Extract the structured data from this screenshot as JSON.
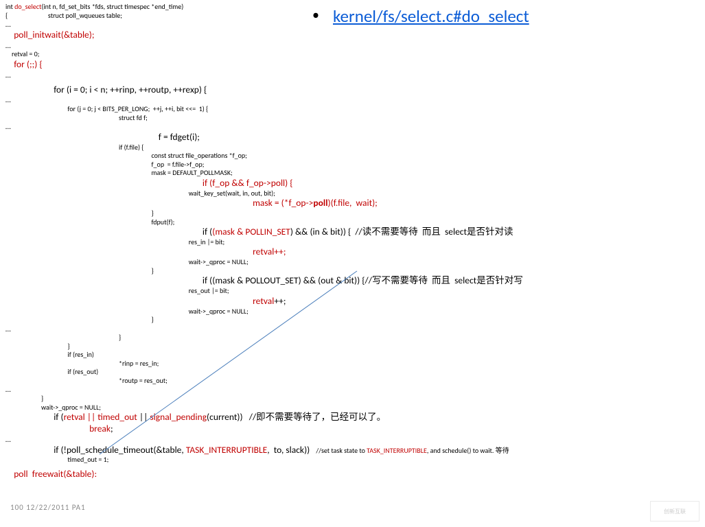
{
  "link_text": " kernel/fs/select.c#do_select",
  "footer": "100   12/22/2011   PA1",
  "watermark": "创新互联",
  "code": {
    "l01a": "int ",
    "l01b": "do_select",
    "l01c": "(int n, fd_set_bits *fds, struct timespec *end_time)",
    "l02": "{                          struct poll_wqueues table;",
    "l03": "…",
    "l04": "    poll_initwait(&table);",
    "l05": "…",
    "l06": "    retval = 0;",
    "l07": "    for (;;) {",
    "l08": "…",
    "l09": "                       for (i = 0; i < n; ++rinp, ++routp, ++rexp) {",
    "l10": "…",
    "l11": "                                        for (j = 0; j < BITS_PER_LONG;  ++j, ++i, bit <<=  1) {",
    "l12": "                                                                         struct fd f;",
    "l13": "…",
    "l14": "                                                                         f = fdget(i);",
    "l15": "                                                                         if (f.file) {",
    "l16": "                                                                                              const struct file_operations *f_op;",
    "l17": "                                                                                              f_op  = f.file->f_op;",
    "l18": "                                                                                              mask = DEFAULT_POLLMASK;",
    "l19a": "                                                                                              ",
    "l19b": "if (f_op && f_op->poll) {",
    "l20": "                                                                                                                      wait_key_set(wait, in, out, bit);",
    "l21a": "                                                                                                                      ",
    "l21b": "mask = (*f_op->",
    "l21c": "poll",
    "l21d": ")(f.file,  wait);",
    "l22": "                                                                                              }",
    "l23": "                                                                                              fdput(f);",
    "l24a": "                                                                                              if (",
    "l24b": "(mask & POLLIN_SET",
    "l24c": ") && (in & bit)) {  //读不需要等待  而且  select是否针对读",
    "l25": "                                                                                                                      res_in |= bit;",
    "l26a": "                                                                                                                      ",
    "l26b": "retval++;",
    "l27": "                                                                                                                      wait->_qproc = NULL;",
    "l28": "                                                                                              }",
    "l29": "                                                                                              if ((mask & POLLOUT_SET) && (out & bit)) {//写不需要等待  而且  select是否针对写",
    "l30": "                                                                                                                      res_out |= bit;",
    "l31a": "                                                                                                                      ",
    "l31b": "retval",
    "l31c": "++;",
    "l32": "                                                                                                                      wait->_qproc = NULL;",
    "l33": "                                                                                              }",
    "l34": "…",
    "l35": "                                                                         }",
    "l36": "                                        }",
    "l37": "                                        if (res_in)",
    "l38": "                                                                         *rinp = res_in;",
    "l39": "                                        if (res_out)",
    "l40": "                                                                         *routp = res_out;",
    "l41": "…",
    "l42": "                       }",
    "l43": "                       wait->_qproc = NULL;",
    "l44a": "                       if (",
    "l44b": "retval || timed_out",
    "l44c": " || ",
    "l44d": "signal_pending",
    "l44e": "(current))   //即不需要等待了，已经可以了。",
    "l45": "                                        break",
    "l45b": ";",
    "l46": "…",
    "l47a": "                       if (!poll_schedule_timeout(&table, ",
    "l47b": "TASK_INTERRUPTIBLE",
    "l47c": ",  to, slack))   ",
    "l47d": "//set task state to ",
    "l47e": "TASK_INTERRUPTIBLE",
    "l47f": ", and schedule() to wait. 等待",
    "l48": "                                        timed_out = 1;",
    "l49": "    poll  freewait(&table):"
  }
}
